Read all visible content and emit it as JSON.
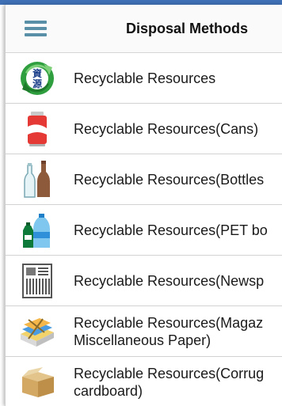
{
  "header": {
    "title": "Disposal Methods",
    "menu_icon": "hamburger-menu-icon"
  },
  "list": [
    {
      "label_lines": [
        "Recyclable Resources"
      ],
      "icon": "recycle-kanji-icon"
    },
    {
      "label_lines": [
        "Recyclable Resources(Cans)"
      ],
      "icon": "can-icon"
    },
    {
      "label_lines": [
        "Recyclable Resources(Bottles"
      ],
      "icon": "glass-bottles-icon"
    },
    {
      "label_lines": [
        "Recyclable Resources(PET bo"
      ],
      "icon": "pet-bottles-icon"
    },
    {
      "label_lines": [
        "Recyclable Resources(Newsp"
      ],
      "icon": "newspaper-icon"
    },
    {
      "label_lines": [
        "Recyclable Resources(Magaz",
        "Miscellaneous Paper)"
      ],
      "icon": "magazine-bundle-icon"
    },
    {
      "label_lines": [
        "Recyclable Resources(Corrug",
        "cardboard)"
      ],
      "icon": "cardboard-box-icon"
    }
  ],
  "icon_text": {
    "recycle_top": "資",
    "recycle_bottom": "源"
  },
  "colors": {
    "accent": "#3f6fb4",
    "menu_icon": "#5a8fa8"
  }
}
